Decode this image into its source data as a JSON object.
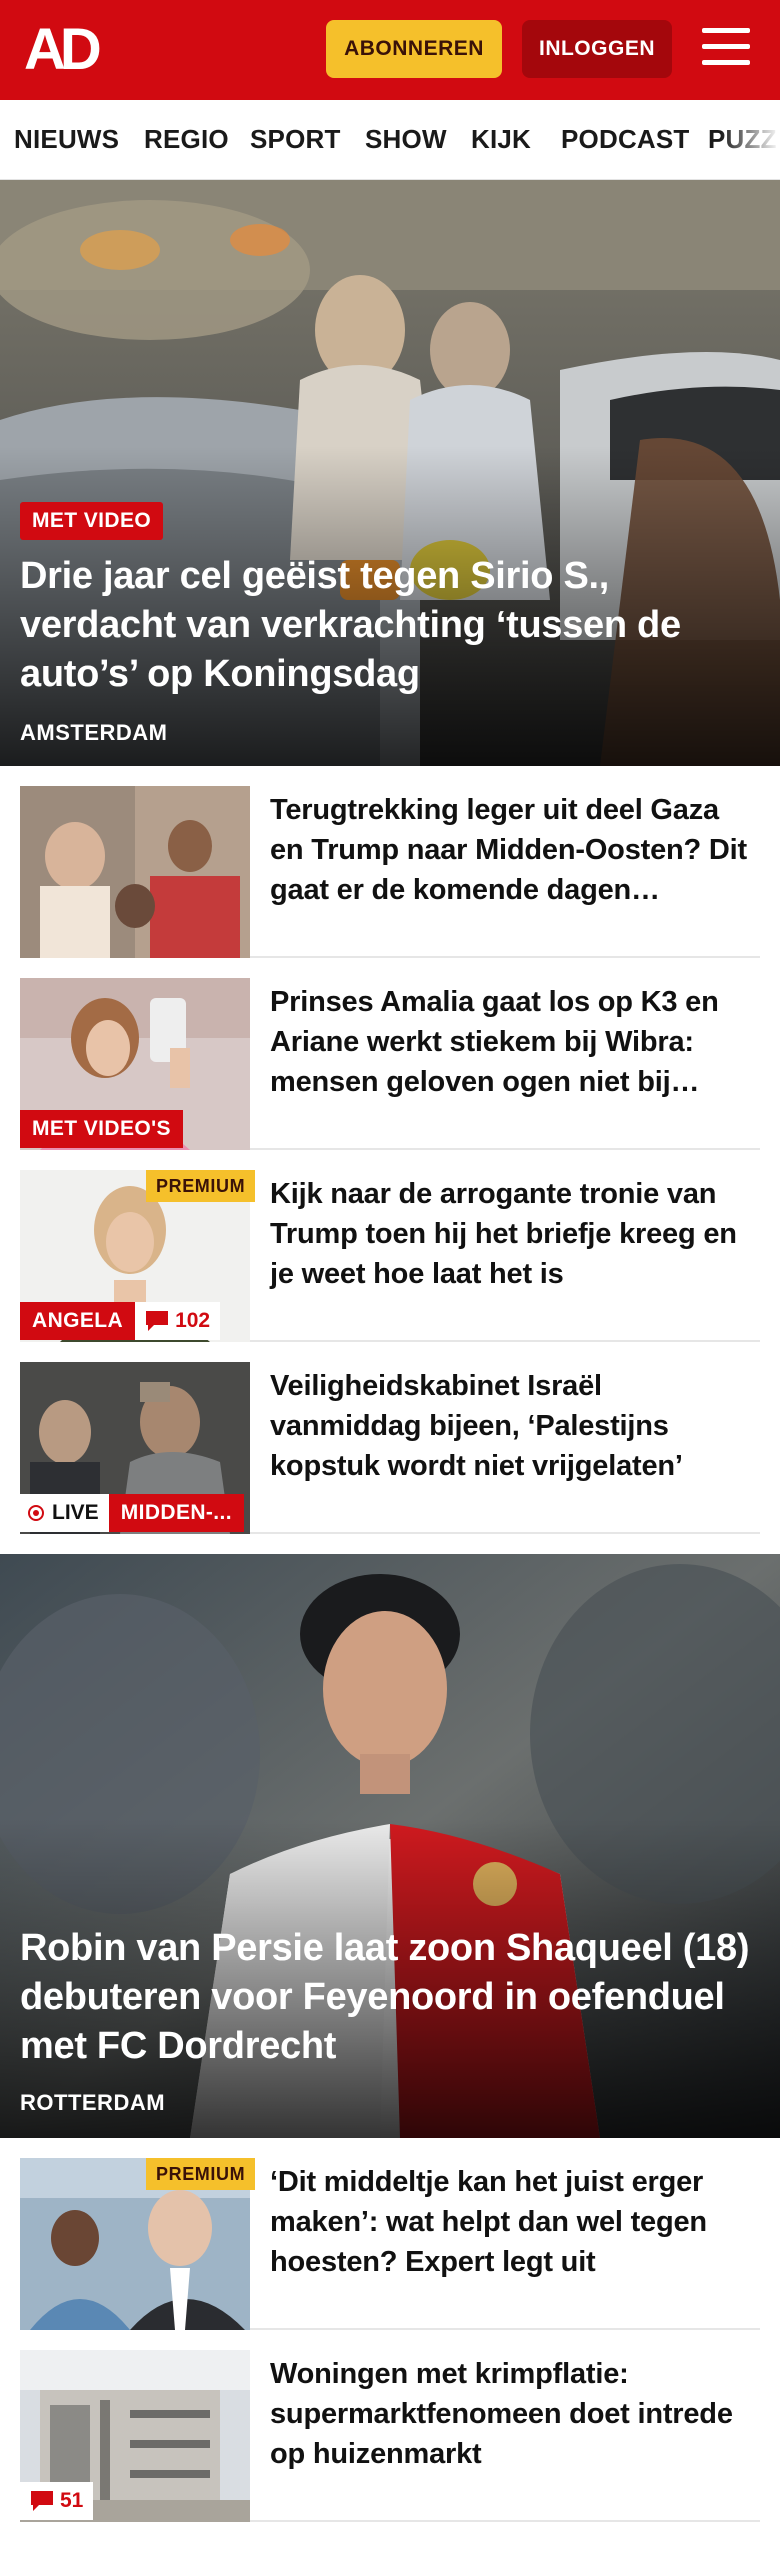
{
  "header": {
    "logo": "AD",
    "subscribe_label": "ABONNEREN",
    "login_label": "INLOGGEN",
    "brand_color": "#d10a11",
    "accent_color": "#f5c02b"
  },
  "nav": {
    "items": [
      "NIEUWS",
      "REGIO",
      "SPORT",
      "SHOW",
      "KIJK",
      "PODCAST",
      "PUZZ"
    ]
  },
  "hero1": {
    "tag": "MET VIDEO",
    "title": "Drie jaar cel geëist tegen Sirio S., verdacht van verkrachting ‘tussen de auto’s’ op Koningsdag",
    "location": "AMSTERDAM"
  },
  "articles1": [
    {
      "title": "Terugtrekking leger uit deel Gaza en Trump naar Midden-Oosten? Dit gaat er de komende dagen…"
    },
    {
      "title": "Prinses Amalia gaat los op K3 en Ariane werkt stiekem bij Wibra: mensen geloven ogen niet bij…",
      "tag": "MET VIDEO'S"
    },
    {
      "title": "Kijk naar de arrogante tronie van Trump toen hij het briefje kreeg en je weet hoe laat het is",
      "premium": "PREMIUM",
      "tag": "ANGELA",
      "comments": "102"
    },
    {
      "title": "Veiligheidskabinet Israël vanmiddag bijeen, ‘Palestijns kopstuk wordt niet vrijgelaten’",
      "live": "LIVE",
      "tag": "MIDDEN-..."
    }
  ],
  "hero2": {
    "title": "Robin van Persie laat zoon Shaqueel (18) debuteren voor Feyenoord in oefenduel met FC Dordrecht",
    "location": "ROTTERDAM"
  },
  "articles2": [
    {
      "title": "‘Dit middeltje kan het juist erger maken’: wat helpt dan wel tegen hoesten? Expert legt uit",
      "premium": "PREMIUM"
    },
    {
      "title": "Woningen met krimpflatie: supermarktfenomeen doet intrede op huizenmarkt",
      "comments": "51"
    }
  ]
}
